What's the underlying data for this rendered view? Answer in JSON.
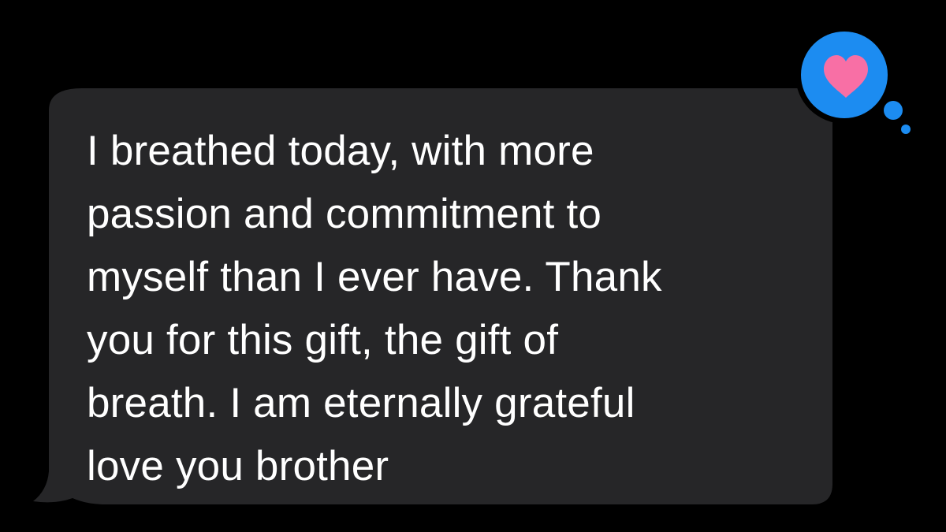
{
  "message": {
    "text": "I breathed today, with more\npassion and commitment to\nmyself than I ever have. Thank\nyou for this gift, the gift of\nbreath. I am eternally grateful\nlove you brother",
    "bubble_color": "#262628",
    "text_color": "#ffffff"
  },
  "reaction": {
    "icon": "heart-icon",
    "badge_color": "#1c8cf1",
    "heart_color": "#f86fa5",
    "outline_color": "#000000"
  },
  "background_color": "#000000"
}
